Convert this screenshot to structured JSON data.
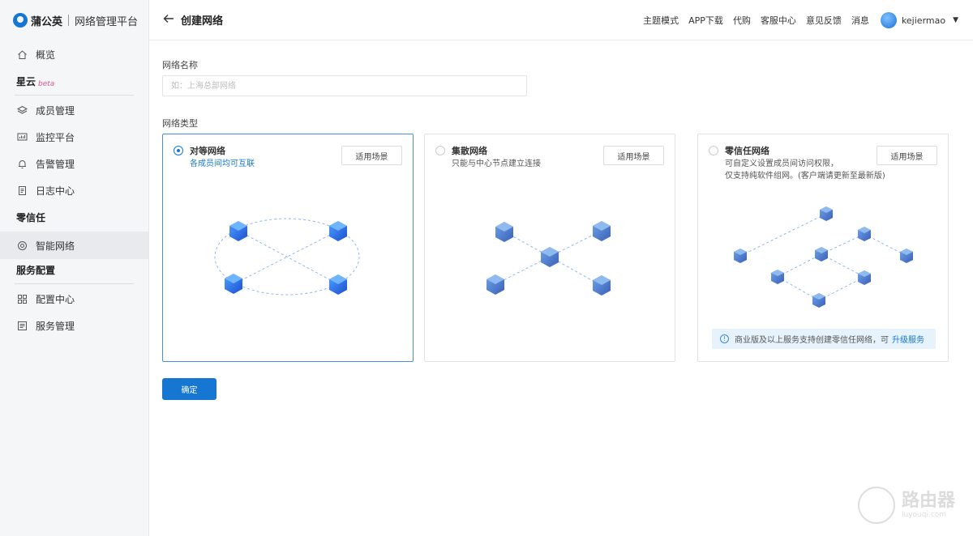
{
  "brand": {
    "name": "蒲公英",
    "subtitle": "网络管理平台"
  },
  "sidebar": {
    "overview": "概览",
    "groups": [
      {
        "label": "星云",
        "badge": "beta"
      },
      {
        "label": "零信任"
      },
      {
        "label": "服务配置"
      }
    ],
    "xingyun_items": [
      "成员管理",
      "监控平台",
      "告警管理",
      "日志中心"
    ],
    "zerotrust_items": [
      "智能网络"
    ],
    "service_items": [
      "配置中心",
      "服务管理"
    ]
  },
  "header": {
    "back_icon": "arrow-left-icon",
    "title": "创建网络",
    "links": [
      "主题模式",
      "APP下载",
      "代购",
      "客服中心",
      "意见反馈",
      "消息"
    ],
    "username": "kejiermao"
  },
  "form": {
    "name_label": "网络名称",
    "name_placeholder": "如：上海总部网络",
    "name_value": "",
    "type_label": "网络类型",
    "types": [
      {
        "title": "对等网络",
        "desc": "各成员间均可互联",
        "scene_button": "适用场景",
        "selected": true
      },
      {
        "title": "集散网络",
        "desc": "只能与中心节点建立连接",
        "scene_button": "适用场景",
        "selected": false
      },
      {
        "title": "零信任网络",
        "desc_line1": "可自定义设置成员间访问权限，",
        "desc_line2": "仅支持纯软件组网。(客户端请更新至最新版)",
        "scene_button": "适用场景",
        "selected": false
      }
    ],
    "notice_text": "商业版及以上服务支持创建零信任网络，可",
    "notice_link": "升级服务",
    "confirm": "确定"
  },
  "watermark": {
    "text": "路由器",
    "url": "luyouqi.com"
  },
  "colors": {
    "primary": "#1677d2",
    "selected_border": "#4a90d9",
    "sidebar_bg": "#f5f6f8"
  }
}
